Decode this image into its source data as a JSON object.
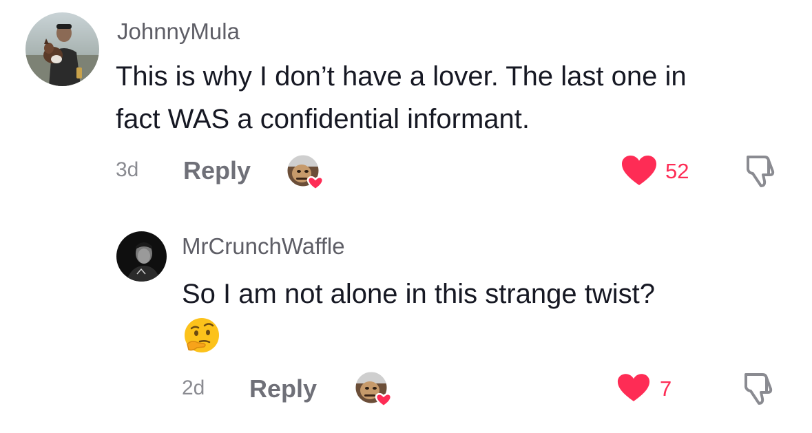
{
  "comments": [
    {
      "username": "JohnnyMula",
      "text_lines": [
        "This is why I don’t have a lover. The last one in",
        "fact WAS a confidential informant."
      ],
      "time": "3d",
      "reply_label": "Reply",
      "likes": "52",
      "avatar_icon": "user-avatar-with-dog",
      "creator_liked_icon": "creator-heart-avatar-icon",
      "like_icon": "heart-icon",
      "dislike_icon": "thumbs-down-icon"
    },
    {
      "username": "MrCrunchWaffle",
      "text_lines": [
        "So I am not alone in this strange twist?"
      ],
      "emoji": "🤔",
      "time": "2d",
      "reply_label": "Reply",
      "likes": "7",
      "avatar_icon": "user-avatar-dark-portrait",
      "creator_liked_icon": "creator-heart-avatar-icon",
      "like_icon": "heart-icon",
      "dislike_icon": "thumbs-down-icon"
    }
  ],
  "colors": {
    "like": "#fe2c55",
    "username": "#5e5e66",
    "text": "#161823",
    "meta": "#8a8b91"
  }
}
